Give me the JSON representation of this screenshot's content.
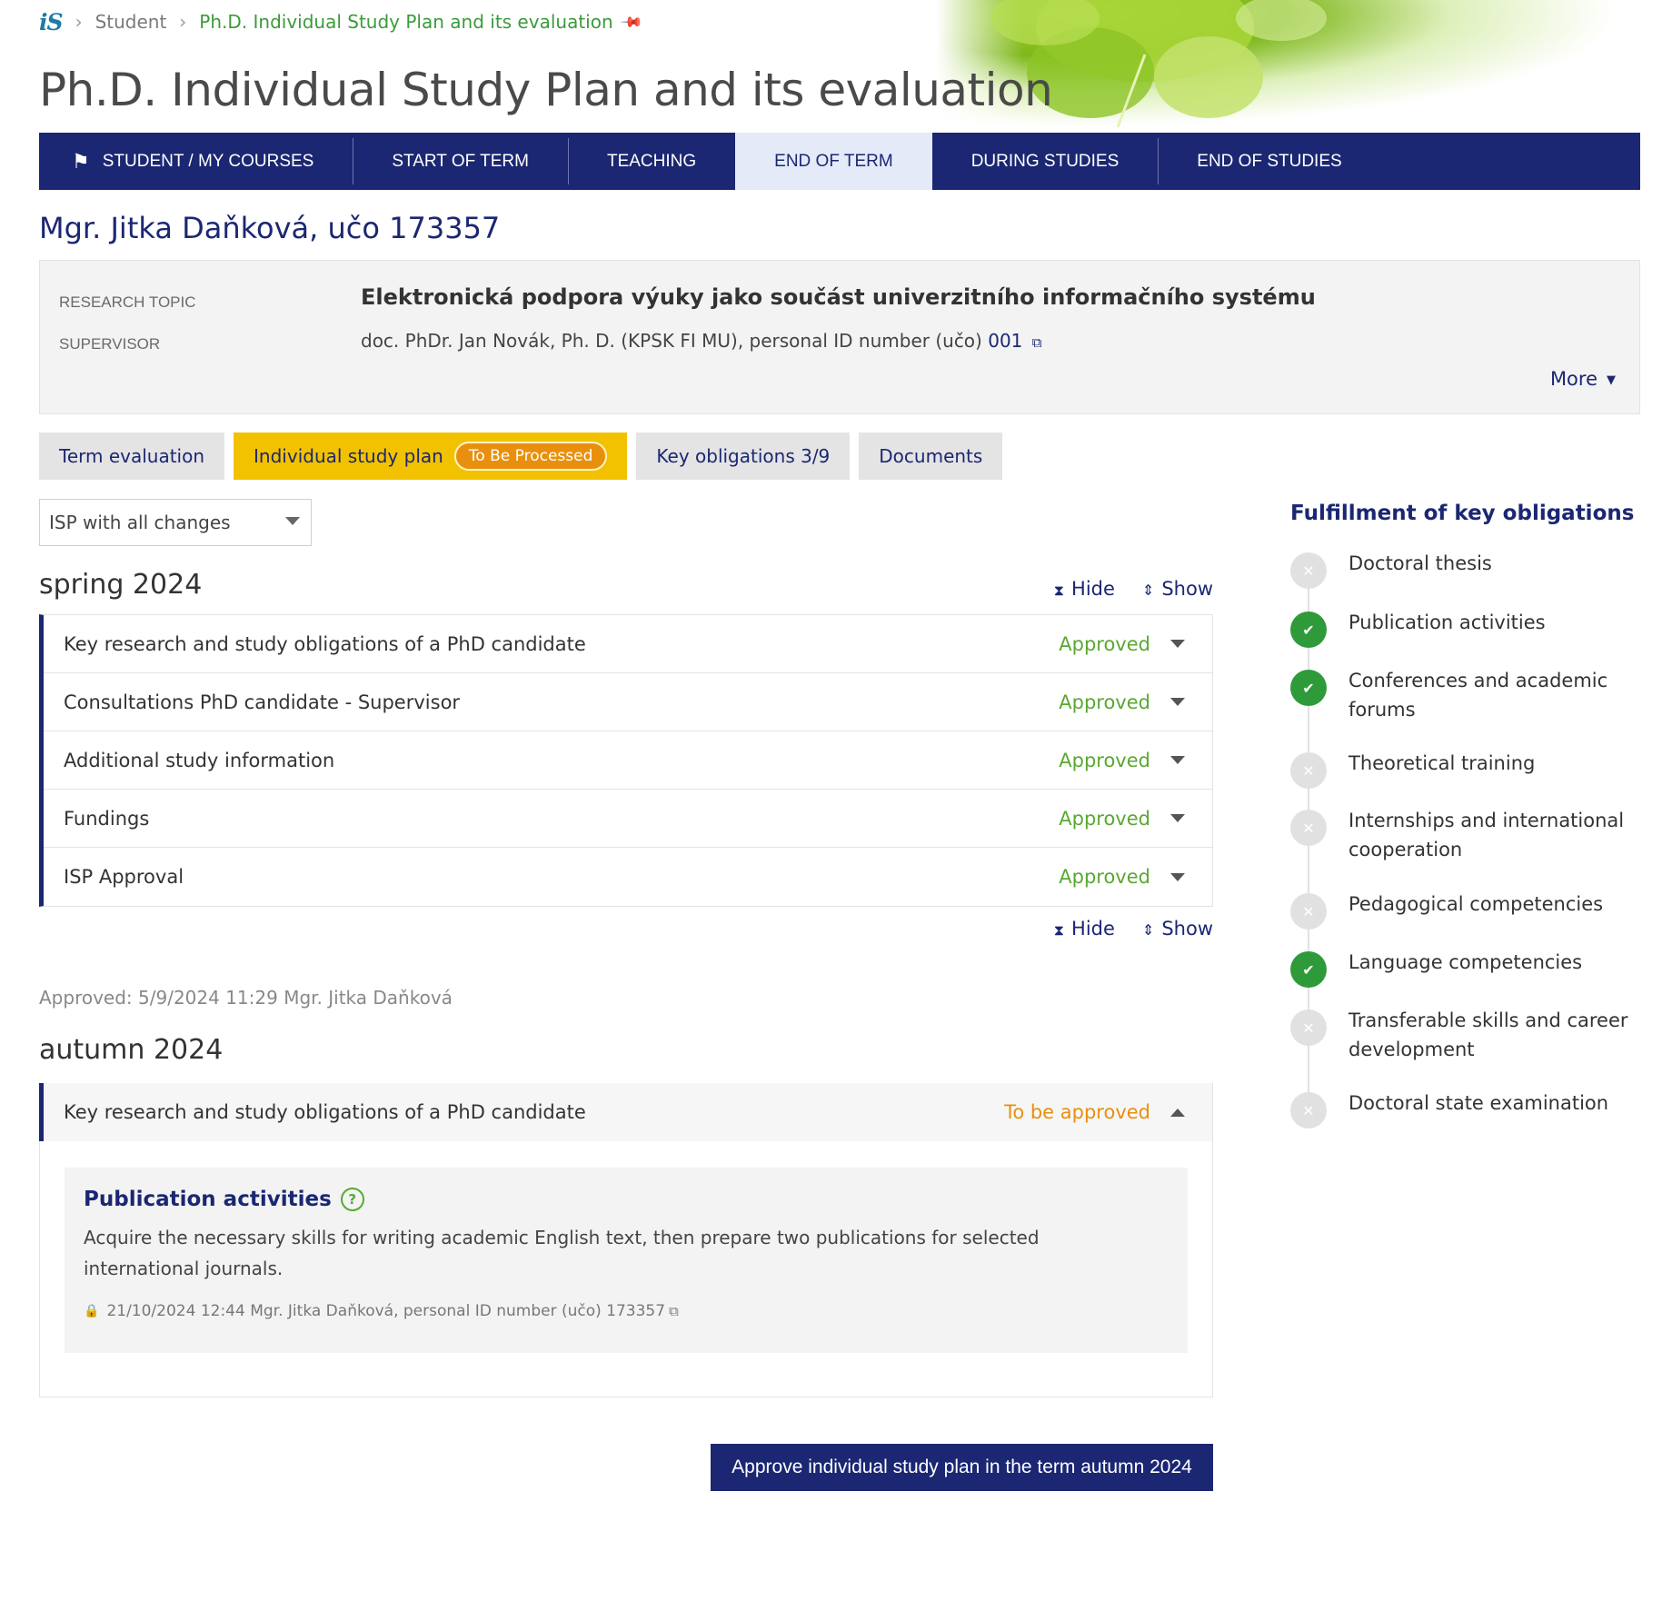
{
  "breadcrumb": {
    "logo": "iS",
    "items": [
      "Student",
      "Ph.D. Individual Study Plan and its evaluation"
    ]
  },
  "page_title": "Ph.D. Individual Study Plan and its evaluation",
  "nav": {
    "items": [
      "STUDENT / MY COURSES",
      "START OF TERM",
      "TEACHING",
      "END OF TERM",
      "DURING STUDIES",
      "END OF STUDIES"
    ],
    "active": "END OF TERM"
  },
  "student": {
    "name": "Mgr. Jitka Daňková, učo 173357",
    "research_topic_label": "RESEARCH TOPIC",
    "research_topic": "Elektronická podpora výuky jako součást univerzitního informačního systému",
    "supervisor_label": "SUPERVISOR",
    "supervisor": "doc. PhDr. Jan Novák, Ph. D. (KPSK FI MU), personal ID number (učo)",
    "supervisor_uco": "001",
    "more": "More"
  },
  "tabs": {
    "term_evaluation": "Term evaluation",
    "isp": "Individual study plan",
    "isp_badge": "To Be Processed",
    "key_obligations": "Key obligations 3/9",
    "documents": "Documents"
  },
  "view_select": {
    "value": "ISP with all changes"
  },
  "controls": {
    "hide": "Hide",
    "show": "Show"
  },
  "spring": {
    "title": "spring 2024",
    "rows": [
      {
        "label": "Key research and study obligations of a PhD candidate",
        "status": "Approved"
      },
      {
        "label": "Consultations PhD candidate - Supervisor",
        "status": "Approved"
      },
      {
        "label": "Additional study information",
        "status": "Approved"
      },
      {
        "label": "Fundings",
        "status": "Approved"
      },
      {
        "label": "ISP Approval",
        "status": "Approved"
      }
    ],
    "approved_note": "Approved: 5/9/2024 11:29 Mgr. Jitka Daňková"
  },
  "autumn": {
    "title": "autumn 2024",
    "row_label": "Key research and study obligations of a PhD candidate",
    "row_status": "To be approved",
    "detail_title": "Publication activities",
    "detail_text": "Acquire the necessary skills for writing academic English text, then prepare two publications for selected international journals.",
    "detail_meta": "21/10/2024 12:44 Mgr. Jitka Daňková, personal ID number (učo) 173357"
  },
  "approve_button": "Approve individual study plan in the term autumn 2024",
  "sidebar": {
    "title": "Fulfillment of key obligations",
    "items": [
      {
        "label": "Doctoral thesis",
        "done": false
      },
      {
        "label": "Publication activities",
        "done": true
      },
      {
        "label": "Conferences and academic forums",
        "done": true
      },
      {
        "label": "Theoretical training",
        "done": false
      },
      {
        "label": "Internships and international cooperation",
        "done": false
      },
      {
        "label": "Pedagogical competencies",
        "done": false
      },
      {
        "label": "Language competencies",
        "done": true
      },
      {
        "label": "Transferable skills and career development",
        "done": false
      },
      {
        "label": "Doctoral state examination",
        "done": false
      }
    ]
  },
  "colors": {
    "nav": "#1b2772",
    "approved": "#5aa832",
    "pending": "#e8900e",
    "active_tab": "#f2c200"
  }
}
